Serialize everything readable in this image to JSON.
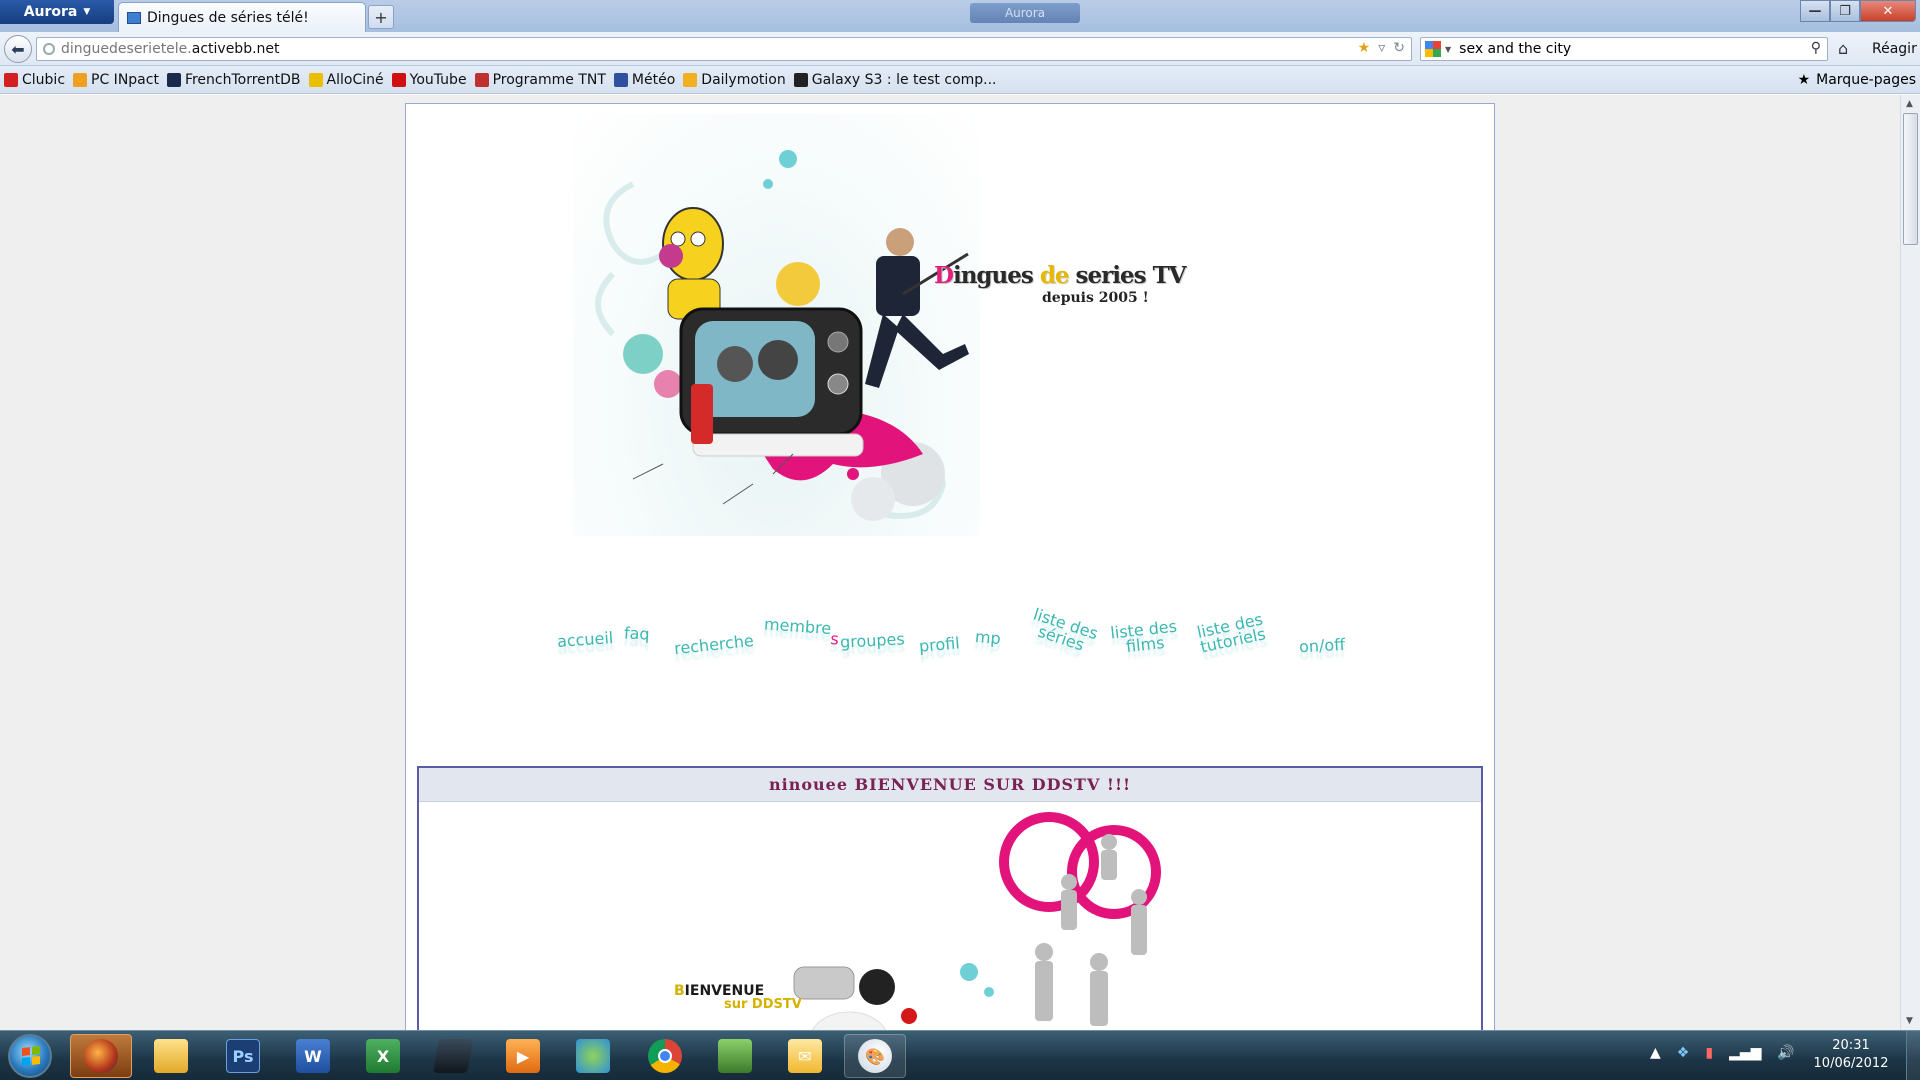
{
  "browser": {
    "menu_button": "Aurora",
    "tab_title": "Dingues de séries télé!",
    "new_tab_symbol": "+",
    "ghost_tab_label": "Aurora",
    "url_subdomain": "dinguedeserietele.",
    "url_domain": "activebb.net",
    "search_value": "sex and the city",
    "right_label": "Réagir",
    "bookmarks": [
      {
        "label": "Clubic",
        "color": "#d42020"
      },
      {
        "label": "PC INpact",
        "color": "#f0a020"
      },
      {
        "label": "FrenchTorrentDB",
        "color": "#1b2a4a"
      },
      {
        "label": "AlloCiné",
        "color": "#e8c000"
      },
      {
        "label": "YouTube",
        "color": "#d01010"
      },
      {
        "label": "Programme TNT",
        "color": "#c03030"
      },
      {
        "label": "Météo",
        "color": "#3050a0"
      },
      {
        "label": "Dailymotion",
        "color": "#f0b020"
      },
      {
        "label": "Galaxy S3 : le test comp...",
        "color": "#222222"
      }
    ],
    "bookmarks_menu": "Marque-pages"
  },
  "site": {
    "title_parts": [
      "D",
      "ingues ",
      "de",
      " series TV"
    ],
    "subtitle": "depuis 2005 !",
    "menu": [
      {
        "label": "accueil"
      },
      {
        "label": "faq"
      },
      {
        "label": "recherche"
      },
      {
        "label": "membre",
        "suffix": "s"
      },
      {
        "label": "groupes"
      },
      {
        "label": "profil"
      },
      {
        "label": "mp"
      },
      {
        "label": "liste des\nséries"
      },
      {
        "label": "liste des\nfilms"
      },
      {
        "label": "liste des\ntutoriels"
      },
      {
        "label": "on/off"
      }
    ],
    "welcome_heading": "ninouee BIENVENUE SUR DDSTV !!!",
    "welcome_banner": {
      "b": "B",
      "rest": "IENVENUE",
      "sur": "sur DDSTV"
    }
  },
  "taskbar": {
    "apps": [
      "firefox-aurora",
      "explorer",
      "photoshop",
      "word",
      "excel",
      "dvd-maker",
      "media-player",
      "messenger",
      "chrome",
      "game",
      "outlook",
      "paint"
    ],
    "time": "20:31",
    "date": "10/06/2012"
  }
}
